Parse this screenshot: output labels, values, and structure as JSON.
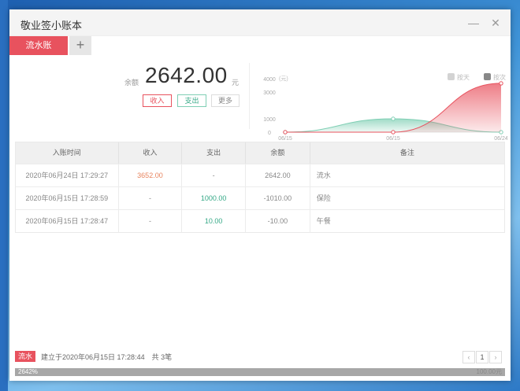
{
  "window": {
    "title": "敬业签小账本",
    "minimize_symbol": "—",
    "close_symbol": "✕"
  },
  "tabs": [
    {
      "label": "流水账",
      "active": true
    }
  ],
  "tab_add_symbol": "+",
  "summary": {
    "balance_label": "余额",
    "balance": "2642.00",
    "unit": "元",
    "buttons": {
      "income": "收入",
      "expense": "支出",
      "more": "更多"
    }
  },
  "chart_data": {
    "type": "area",
    "x": [
      "06/15",
      "06/15",
      "06/24"
    ],
    "series": [
      {
        "values": [
          0,
          1000,
          0
        ],
        "color": "#7fcfb4"
      },
      {
        "values": [
          0,
          0,
          3652
        ],
        "color": "#e8525e"
      }
    ],
    "y_ticks": [
      "0",
      "1000",
      "3000",
      "4000"
    ],
    "y_unit": "(元)",
    "ylim": [
      0,
      4000
    ],
    "legend": [
      {
        "label": "按天",
        "color": "#d3d3d3"
      },
      {
        "label": "按次",
        "color": "#888888"
      }
    ],
    "legend_position": "top-right"
  },
  "table": {
    "headers": [
      "入账时间",
      "收入",
      "支出",
      "余额",
      "备注"
    ],
    "rows": [
      {
        "time": "2020年06月24日 17:29:27",
        "income": "3652.00",
        "expense": "-",
        "balance": "2642.00",
        "note": "流水"
      },
      {
        "time": "2020年06月15日 17:28:59",
        "income": "-",
        "expense": "1000.00",
        "balance": "-1010.00",
        "note": "保险"
      },
      {
        "time": "2020年06月15日 17:28:47",
        "income": "-",
        "expense": "10.00",
        "balance": "-10.00",
        "note": "午餐"
      }
    ]
  },
  "footer": {
    "tag": "流水",
    "created_text": "建立于2020年06月15日 17:28:44　共 3笔",
    "pager": {
      "prev": "‹",
      "current": "1",
      "next": "›"
    }
  },
  "status": {
    "left": "2642%",
    "right": "100.00元",
    "progress": 1.0
  },
  "colors": {
    "accent": "#e8525e",
    "income": "#e8845e",
    "expense": "#36a987"
  }
}
